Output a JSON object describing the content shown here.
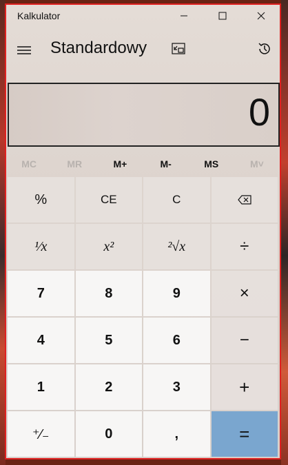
{
  "window": {
    "title": "Kalkulator"
  },
  "header": {
    "mode": "Standardowy"
  },
  "display": {
    "value": "0"
  },
  "memory": [
    {
      "label": "MC",
      "enabled": false
    },
    {
      "label": "MR",
      "enabled": false
    },
    {
      "label": "M+",
      "enabled": true
    },
    {
      "label": "M-",
      "enabled": true
    },
    {
      "label": "MS",
      "enabled": true
    },
    {
      "label": "M˅",
      "enabled": false
    }
  ],
  "keys": {
    "percent": "%",
    "ce": "CE",
    "c": "C",
    "reciprocal": "¹⁄x",
    "square": "x²",
    "sqrt": "²√x",
    "divide": "÷",
    "seven": "7",
    "eight": "8",
    "nine": "9",
    "multiply": "×",
    "four": "4",
    "five": "5",
    "six": "6",
    "minus": "−",
    "one": "1",
    "two": "2",
    "three": "3",
    "plus": "+",
    "negate": "⁺⁄₋",
    "zero": "0",
    "decimal": ",",
    "equals": "="
  },
  "colors": {
    "equals_key": "#7aa6cf",
    "window_border": "#e02020"
  },
  "icons": [
    "minimize-icon",
    "maximize-icon",
    "close-icon",
    "hamburger-menu-icon",
    "keep-on-top-icon",
    "history-icon",
    "backspace-icon"
  ]
}
